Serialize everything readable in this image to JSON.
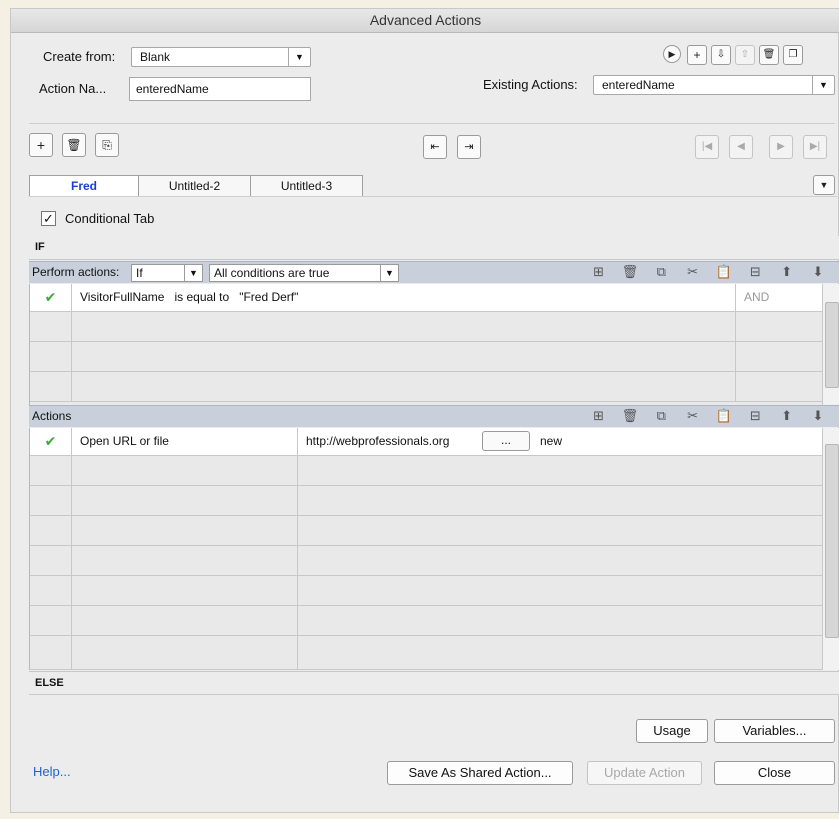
{
  "window": {
    "title": "Advanced Actions"
  },
  "header": {
    "create_from_label": "Create from:",
    "create_from_value": "Blank",
    "action_name_label": "Action Na...",
    "action_name_value": "enteredName",
    "existing_actions_label": "Existing Actions:",
    "existing_actions_value": "enteredName"
  },
  "tabs": [
    {
      "label": "Fred",
      "active": true
    },
    {
      "label": "Untitled-2",
      "active": false
    },
    {
      "label": "Untitled-3",
      "active": false
    }
  ],
  "conditional_tab_label": "Conditional Tab",
  "conditional_checked": true,
  "if_label": "IF",
  "perform": {
    "label": "Perform actions:",
    "mode": "If",
    "condition_mode": "All conditions are true"
  },
  "conditions": [
    {
      "variable": "VisitorFullName",
      "operator": "is equal to",
      "value": "\"Fred Derf\"",
      "logic": "AND"
    }
  ],
  "actions_label": "Actions",
  "actions": [
    {
      "action": "Open URL or file",
      "target": "http://webprofessionals.org",
      "browse_label": "...",
      "window": "new"
    }
  ],
  "else_label": "ELSE",
  "buttons": {
    "usage": "Usage",
    "variables": "Variables...",
    "help": "Help...",
    "save_shared": "Save As Shared Action...",
    "update": "Update Action",
    "close": "Close"
  },
  "colors": {
    "check": "#3aa83a",
    "active_tab": "#1a3dd6",
    "link": "#1a62d6",
    "section_bar": "#c9d0dc"
  }
}
